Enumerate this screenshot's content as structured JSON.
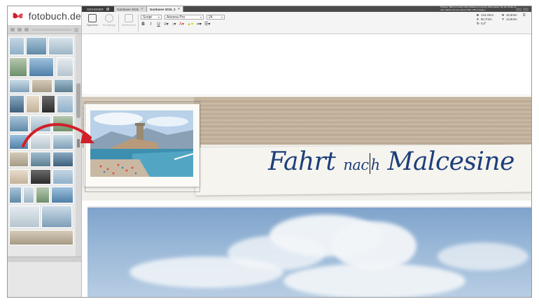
{
  "app": {
    "logo_text": "fotobuch.de",
    "designer_tab": "DESIGNER"
  },
  "tabs": [
    {
      "label": "Gardasee 2016",
      "active": false
    },
    {
      "label": "Gardasee 2016_2",
      "active": true
    }
  ],
  "toolbar": {
    "save_label": "Speichern",
    "undo_label": "Rückgängig",
    "redo_label": "Wiederholen",
    "style_select": "Script",
    "font_select": "Arizona Pro",
    "size_select": "24",
    "bold": "B",
    "italic": "I",
    "underline": "U"
  },
  "hint": {
    "text": "Problem: Bild ist zu klein oder Auflösung zu gering. Bitte passen Sie die Größe an oder wählen Sie ein anderes Bild. Hilfe anzeigen"
  },
  "coords": {
    "b_label": "B",
    "b_value": "144,4mm",
    "h_label": "H",
    "h_value": "15,5mm",
    "x_label": "X",
    "x_value": "50,7mm",
    "y_label": "Y",
    "y_value": "14,8mm",
    "r_value": "0,0°"
  },
  "canvas": {
    "title_part1": "Fahrt",
    "title_small": "nac",
    "title_small2": "h",
    "title_part2": "Malcesine"
  },
  "colors": {
    "title_blue": "#1d3f7a",
    "arrow_red": "#d0202a",
    "logo_red": "#d0202a"
  }
}
